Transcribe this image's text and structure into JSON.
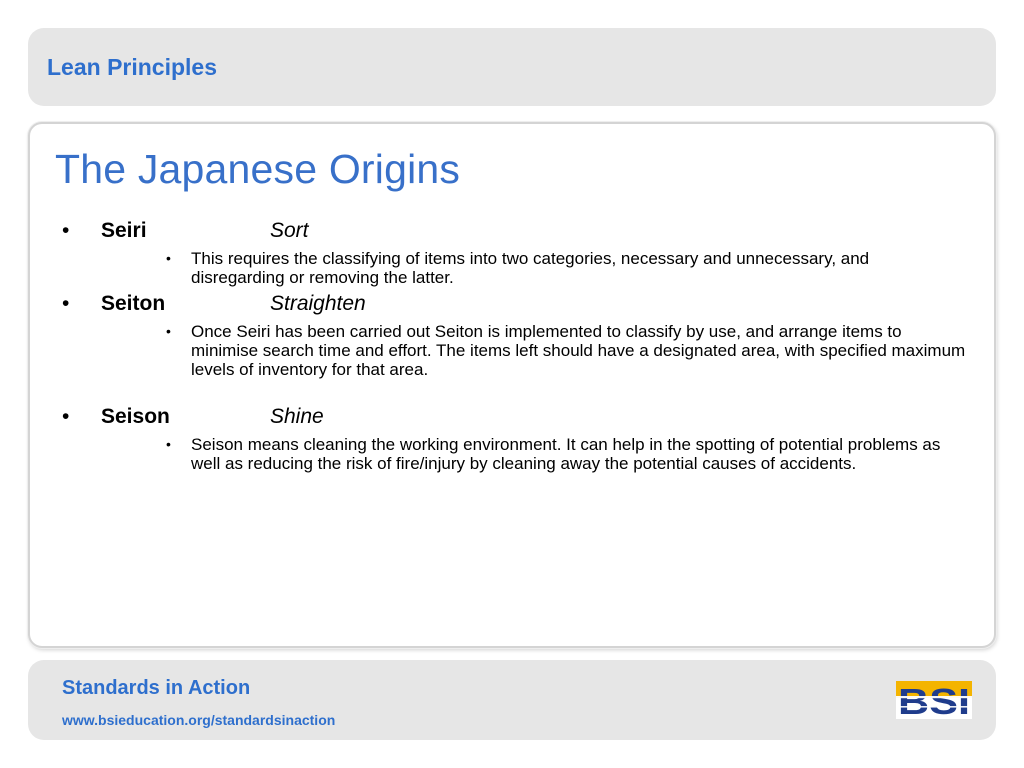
{
  "header": {
    "title": "Lean Principles"
  },
  "slide": {
    "title": "The Japanese Origins",
    "items": [
      {
        "term": "Seiri",
        "meaning": "Sort",
        "detail": "This requires the classifying of items into two categories, necessary and unnecessary, and disregarding or removing the latter."
      },
      {
        "term": "Seiton",
        "meaning": "Straighten",
        "detail": "Once Seiri has been carried out Seiton is implemented to classify by use, and arrange items to minimise search time and effort. The items left should have a designated area, with specified maximum levels of inventory for that area."
      },
      {
        "term": "Seison",
        "meaning": "Shine",
        "detail": "Seison means cleaning the working environment. It can help in the spotting of potential problems as well as reducing the risk of fire/injury by cleaning away the potential causes of accidents."
      }
    ],
    "bullet_glyph": "•"
  },
  "footer": {
    "title": "Standards in Action",
    "url": "www.bsieducation.org/standardsinaction",
    "logo_text": "BSI"
  },
  "colors": {
    "accent_blue": "#2e6fcd",
    "title_blue": "#3870c9",
    "panel_grey": "#e6e6e6",
    "logo_navy": "#1f3c8c",
    "logo_gold": "#f4b400"
  }
}
